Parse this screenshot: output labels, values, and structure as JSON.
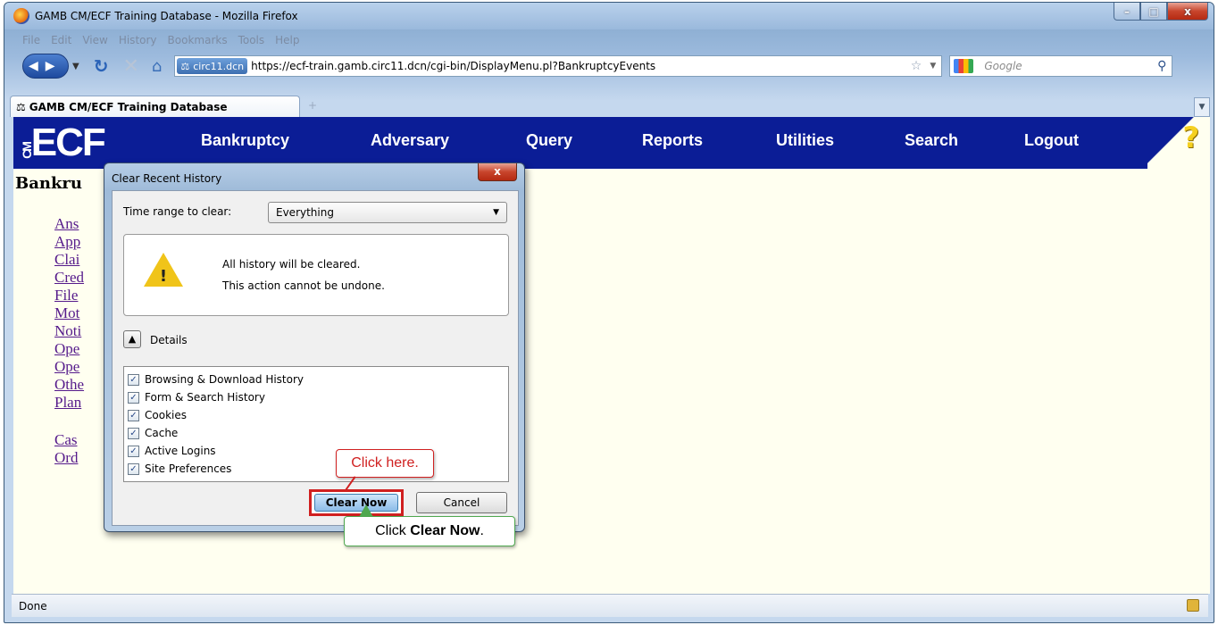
{
  "window": {
    "title": "GAMB CM/ECF Training Database - Mozilla Firefox",
    "minimize": "–",
    "maximize": "□",
    "close": "x"
  },
  "menu": [
    "File",
    "Edit",
    "View",
    "History",
    "Bookmarks",
    "Tools",
    "Help"
  ],
  "navbar": {
    "site_identity": "circ11.dcn",
    "url": "https://ecf-train.gamb.circ11.dcn/cgi-bin/DisplayMenu.pl?BankruptcyEvents",
    "search_placeholder": "Google"
  },
  "tab": {
    "label": "GAMB CM/ECF Training Database",
    "new_tab": "+"
  },
  "ecf": {
    "logo": "ECF",
    "logo_prefix": "CM",
    "nav": [
      "Bankruptcy",
      "Adversary",
      "Query",
      "Reports",
      "Utilities",
      "Search",
      "Logout"
    ],
    "help": "?"
  },
  "page": {
    "heading": "Bankru",
    "links": [
      "Ans",
      "App",
      "Clai",
      "Cred",
      "File",
      "Mot",
      "Noti",
      "Ope",
      "Ope",
      "Othe",
      "Plan"
    ],
    "links2": [
      "Cas",
      "Ord"
    ]
  },
  "status": {
    "text": "Done"
  },
  "dialog": {
    "title": "Clear Recent History",
    "close": "x",
    "time_label": "Time range to clear:",
    "time_value": "Everything",
    "warning_line1": "All history will be cleared.",
    "warning_line2": "This action cannot be undone.",
    "details_label": "Details",
    "items": [
      "Browsing & Download History",
      "Form & Search History",
      "Cookies",
      "Cache",
      "Active Logins",
      "Site Preferences"
    ],
    "clear_button": "Clear Now",
    "cancel_button": "Cancel"
  },
  "callouts": {
    "red": "Click here.",
    "green_prefix": "Click ",
    "green_bold": "Clear Now",
    "green_suffix": "."
  }
}
